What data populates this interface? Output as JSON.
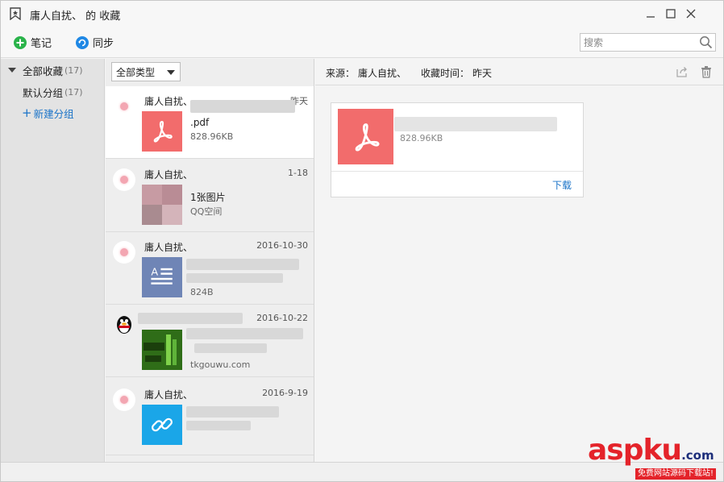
{
  "window": {
    "title": "庸人自扰、 的 收藏",
    "icons": {
      "app": "bookmark-icon",
      "minimize": "minimize-icon",
      "maximize": "maximize-icon",
      "close": "close-icon"
    }
  },
  "toolbar": {
    "note_label": "笔记",
    "sync_label": "同步",
    "search_placeholder": "搜索",
    "colors": {
      "note": "#2ab34a",
      "sync": "#1f88e5"
    }
  },
  "sidebar": {
    "all": {
      "label": "全部收藏",
      "count": "(17)"
    },
    "default_group": {
      "label": "默认分组",
      "count": "(17)"
    },
    "new_group": {
      "label": "新建分组"
    }
  },
  "list": {
    "filter": {
      "selected": "全部类型"
    },
    "items": [
      {
        "author": "庸人自扰、",
        "date": "昨天",
        "line1": ".pdf",
        "line2": "828.96KB",
        "thumb": "pdf-icon",
        "color": "#f26c6c"
      },
      {
        "author": "庸人自扰、",
        "date": "1-18",
        "line1": "1张图片",
        "line2": "QQ空间",
        "thumb": "image-thumbnail"
      },
      {
        "author": "庸人自扰、",
        "date": "2016-10-30",
        "line1": "",
        "line2": "824B",
        "thumb": "document-icon",
        "color": "#6f85b6"
      },
      {
        "author": "",
        "date": "2016-10-22",
        "line1": "",
        "line2": "tkgouwu.com",
        "thumb": "web-thumbnail"
      },
      {
        "author": "庸人自扰、",
        "date": "2016-9-19",
        "line1": "",
        "line2": "",
        "thumb": "link-icon",
        "color": "#1aa6e8"
      }
    ]
  },
  "detail": {
    "source_label": "来源：",
    "source_value": "庸人自扰、",
    "time_label": "收藏时间：",
    "time_value": "昨天",
    "card": {
      "size": "828.96KB",
      "download_label": "下载",
      "thumb_color": "#f26c6c"
    }
  },
  "watermark": {
    "main": "aspku",
    "suffix": ".com",
    "sub": "免费网站源码下载站!"
  }
}
